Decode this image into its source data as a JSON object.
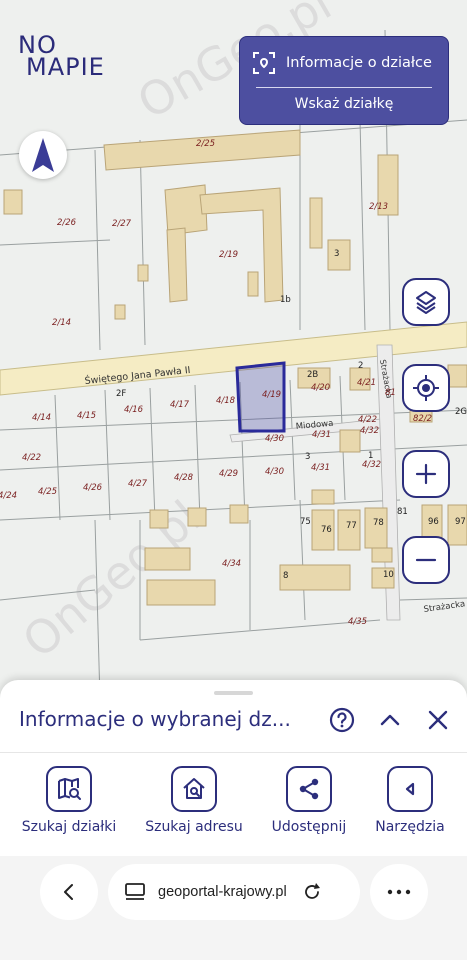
{
  "app": {
    "logo_line1": "NO",
    "logo_line2": "MAPIE"
  },
  "info_panel": {
    "title": "Informacje o działce",
    "action": "Wskaż działkę"
  },
  "map": {
    "street_main": "Świętego Jana Pawła II",
    "street_miodowa": "Miodowa",
    "street_strazacka": "Strażacka",
    "street_side": "Strażacka",
    "parcels": [
      "2/25",
      "2/26",
      "2/27",
      "2/19",
      "2/13",
      "2/14",
      "3",
      "1b",
      "2B",
      "2",
      "4/20",
      "4/21",
      "81",
      "4/14",
      "4/15",
      "2F",
      "4/16",
      "4/17",
      "4/18",
      "4/19",
      "4/22",
      "4/30",
      "4/31",
      "4/32",
      "82/2",
      "2G",
      "4/22",
      "4/30",
      "3",
      "4/31",
      "1",
      "4/32",
      "4/24",
      "4/25",
      "4/26",
      "4/27",
      "4/28",
      "4/29",
      "75",
      "76",
      "77",
      "78",
      "81",
      "96",
      "97",
      "4/34",
      "8",
      "10",
      "4/35"
    ],
    "watermark": "OnGeo.pl",
    "selected_color": "#4b4ba8"
  },
  "map_controls": {
    "layers_icon": "layers-icon",
    "locate_icon": "locate-icon",
    "zoom_in_icon": "plus-icon",
    "zoom_out_icon": "minus-icon"
  },
  "sheet": {
    "title": "Informacje o wybranej dz...",
    "tools": [
      {
        "label": "Szukaj działki",
        "icon": "map-search-icon"
      },
      {
        "label": "Szukaj adresu",
        "icon": "home-search-icon"
      },
      {
        "label": "Udostępnij",
        "icon": "share-icon"
      },
      {
        "label": "Narzędzia",
        "icon": "tools-arrow-icon"
      }
    ]
  },
  "browser": {
    "url": "geoportal-krajowy.pl"
  },
  "colors": {
    "brand": "#2c2e7c",
    "panel": "#4d4fa0"
  }
}
